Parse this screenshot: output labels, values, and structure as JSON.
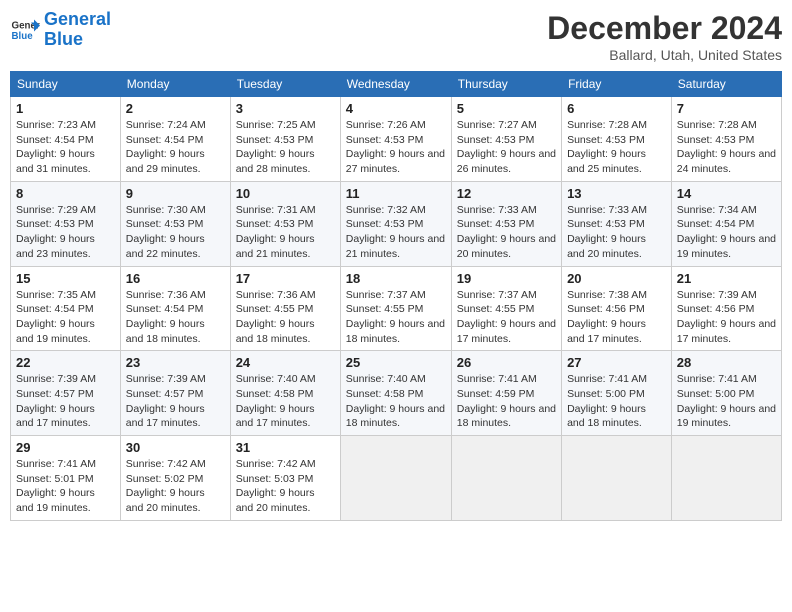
{
  "logo": {
    "line1": "General",
    "line2": "Blue"
  },
  "header": {
    "month": "December 2024",
    "location": "Ballard, Utah, United States"
  },
  "weekdays": [
    "Sunday",
    "Monday",
    "Tuesday",
    "Wednesday",
    "Thursday",
    "Friday",
    "Saturday"
  ],
  "weeks": [
    [
      {
        "day": "1",
        "sunrise": "7:23 AM",
        "sunset": "4:54 PM",
        "daylight": "9 hours and 31 minutes."
      },
      {
        "day": "2",
        "sunrise": "7:24 AM",
        "sunset": "4:54 PM",
        "daylight": "9 hours and 29 minutes."
      },
      {
        "day": "3",
        "sunrise": "7:25 AM",
        "sunset": "4:53 PM",
        "daylight": "9 hours and 28 minutes."
      },
      {
        "day": "4",
        "sunrise": "7:26 AM",
        "sunset": "4:53 PM",
        "daylight": "9 hours and 27 minutes."
      },
      {
        "day": "5",
        "sunrise": "7:27 AM",
        "sunset": "4:53 PM",
        "daylight": "9 hours and 26 minutes."
      },
      {
        "day": "6",
        "sunrise": "7:28 AM",
        "sunset": "4:53 PM",
        "daylight": "9 hours and 25 minutes."
      },
      {
        "day": "7",
        "sunrise": "7:28 AM",
        "sunset": "4:53 PM",
        "daylight": "9 hours and 24 minutes."
      }
    ],
    [
      {
        "day": "8",
        "sunrise": "7:29 AM",
        "sunset": "4:53 PM",
        "daylight": "9 hours and 23 minutes."
      },
      {
        "day": "9",
        "sunrise": "7:30 AM",
        "sunset": "4:53 PM",
        "daylight": "9 hours and 22 minutes."
      },
      {
        "day": "10",
        "sunrise": "7:31 AM",
        "sunset": "4:53 PM",
        "daylight": "9 hours and 21 minutes."
      },
      {
        "day": "11",
        "sunrise": "7:32 AM",
        "sunset": "4:53 PM",
        "daylight": "9 hours and 21 minutes."
      },
      {
        "day": "12",
        "sunrise": "7:33 AM",
        "sunset": "4:53 PM",
        "daylight": "9 hours and 20 minutes."
      },
      {
        "day": "13",
        "sunrise": "7:33 AM",
        "sunset": "4:53 PM",
        "daylight": "9 hours and 20 minutes."
      },
      {
        "day": "14",
        "sunrise": "7:34 AM",
        "sunset": "4:54 PM",
        "daylight": "9 hours and 19 minutes."
      }
    ],
    [
      {
        "day": "15",
        "sunrise": "7:35 AM",
        "sunset": "4:54 PM",
        "daylight": "9 hours and 19 minutes."
      },
      {
        "day": "16",
        "sunrise": "7:36 AM",
        "sunset": "4:54 PM",
        "daylight": "9 hours and 18 minutes."
      },
      {
        "day": "17",
        "sunrise": "7:36 AM",
        "sunset": "4:55 PM",
        "daylight": "9 hours and 18 minutes."
      },
      {
        "day": "18",
        "sunrise": "7:37 AM",
        "sunset": "4:55 PM",
        "daylight": "9 hours and 18 minutes."
      },
      {
        "day": "19",
        "sunrise": "7:37 AM",
        "sunset": "4:55 PM",
        "daylight": "9 hours and 17 minutes."
      },
      {
        "day": "20",
        "sunrise": "7:38 AM",
        "sunset": "4:56 PM",
        "daylight": "9 hours and 17 minutes."
      },
      {
        "day": "21",
        "sunrise": "7:39 AM",
        "sunset": "4:56 PM",
        "daylight": "9 hours and 17 minutes."
      }
    ],
    [
      {
        "day": "22",
        "sunrise": "7:39 AM",
        "sunset": "4:57 PM",
        "daylight": "9 hours and 17 minutes."
      },
      {
        "day": "23",
        "sunrise": "7:39 AM",
        "sunset": "4:57 PM",
        "daylight": "9 hours and 17 minutes."
      },
      {
        "day": "24",
        "sunrise": "7:40 AM",
        "sunset": "4:58 PM",
        "daylight": "9 hours and 17 minutes."
      },
      {
        "day": "25",
        "sunrise": "7:40 AM",
        "sunset": "4:58 PM",
        "daylight": "9 hours and 18 minutes."
      },
      {
        "day": "26",
        "sunrise": "7:41 AM",
        "sunset": "4:59 PM",
        "daylight": "9 hours and 18 minutes."
      },
      {
        "day": "27",
        "sunrise": "7:41 AM",
        "sunset": "5:00 PM",
        "daylight": "9 hours and 18 minutes."
      },
      {
        "day": "28",
        "sunrise": "7:41 AM",
        "sunset": "5:00 PM",
        "daylight": "9 hours and 19 minutes."
      }
    ],
    [
      {
        "day": "29",
        "sunrise": "7:41 AM",
        "sunset": "5:01 PM",
        "daylight": "9 hours and 19 minutes."
      },
      {
        "day": "30",
        "sunrise": "7:42 AM",
        "sunset": "5:02 PM",
        "daylight": "9 hours and 20 minutes."
      },
      {
        "day": "31",
        "sunrise": "7:42 AM",
        "sunset": "5:03 PM",
        "daylight": "9 hours and 20 minutes."
      },
      null,
      null,
      null,
      null
    ]
  ]
}
